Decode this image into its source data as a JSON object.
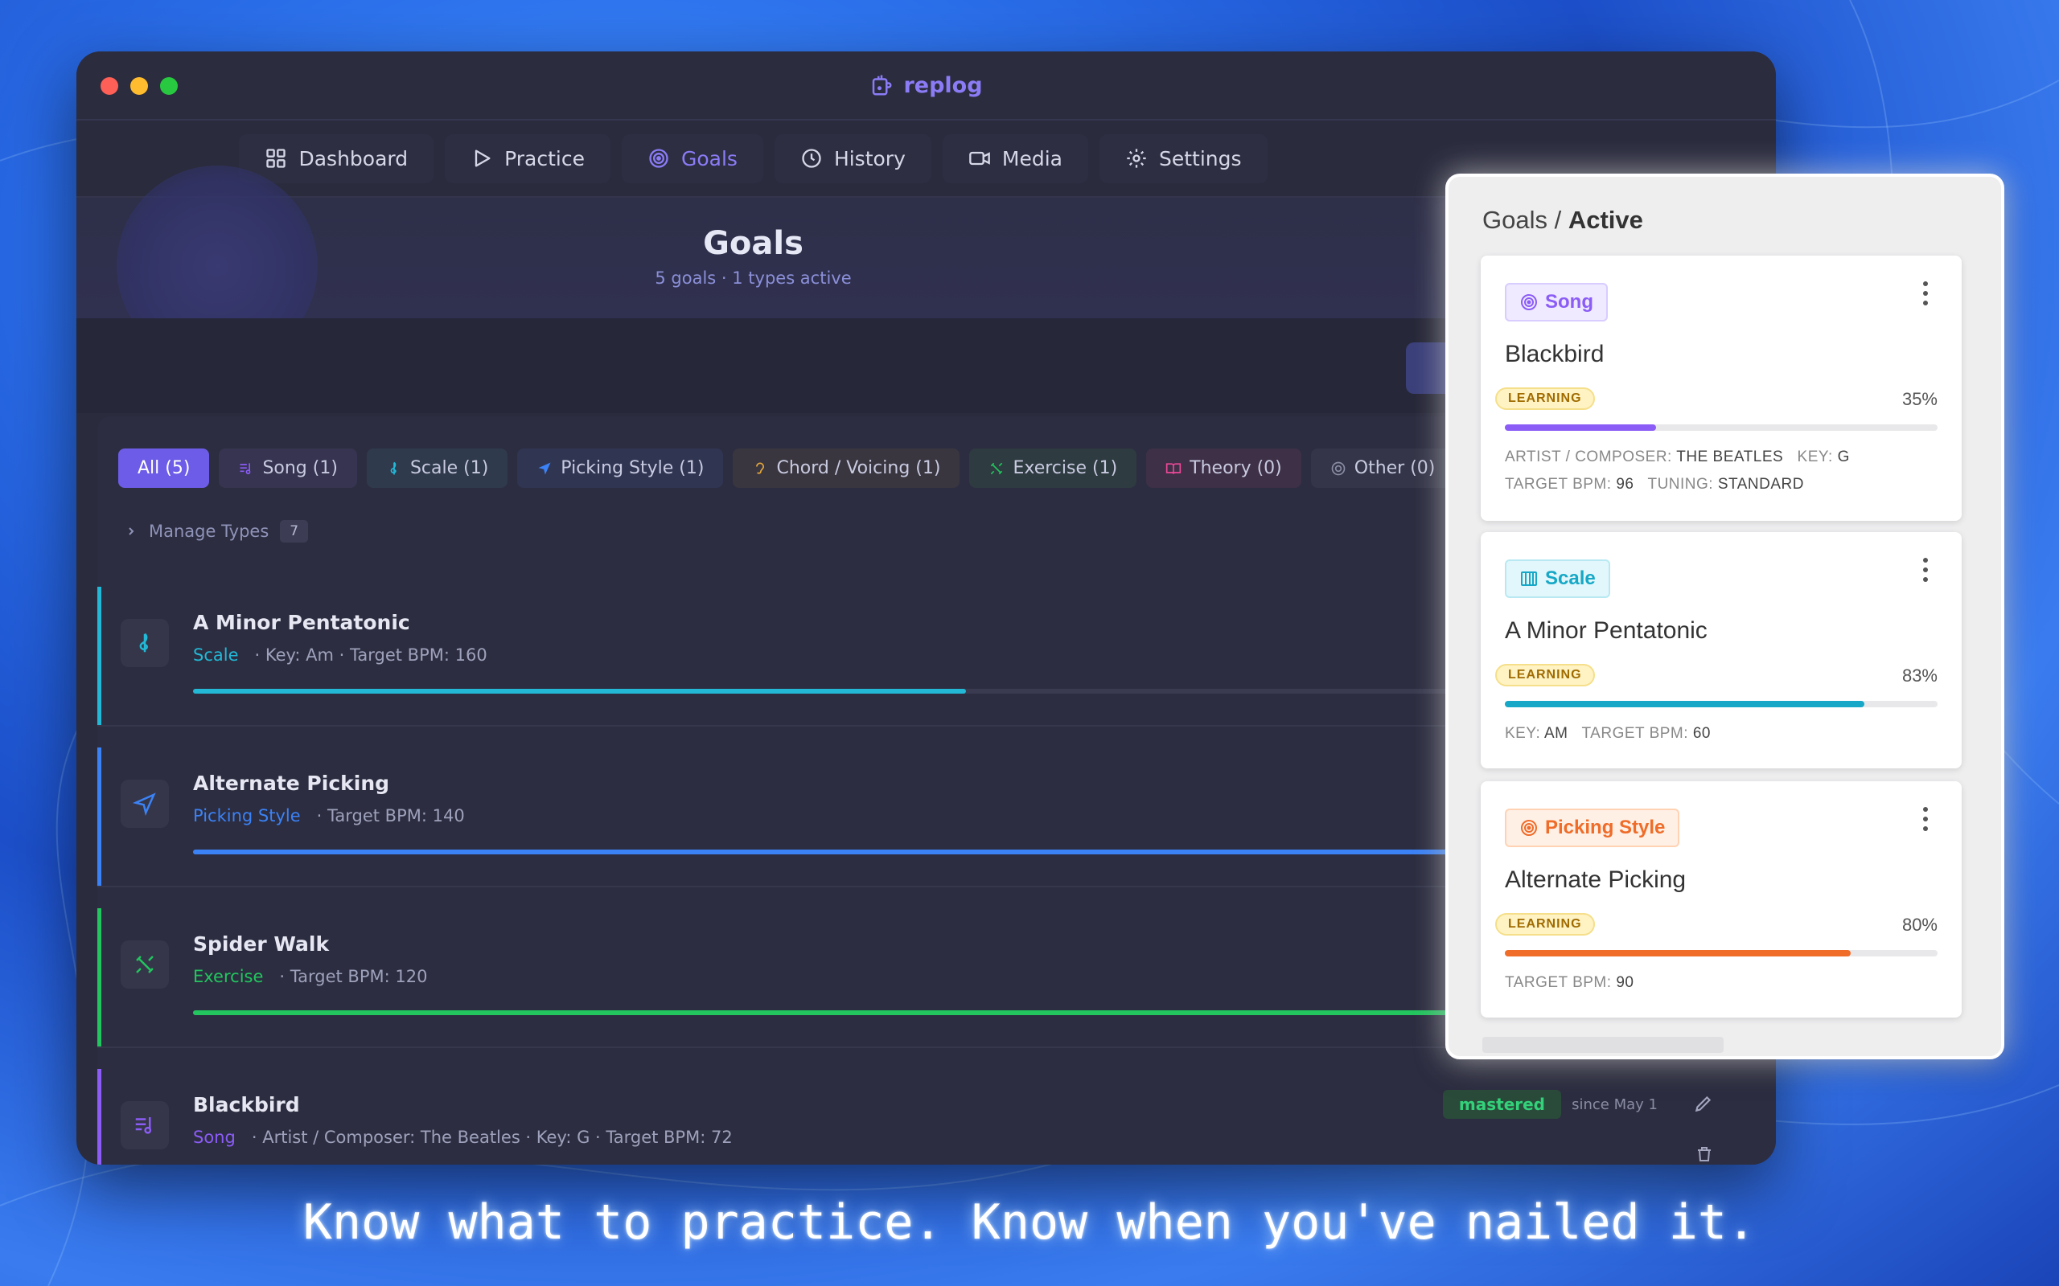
{
  "app": {
    "title": "replog"
  },
  "nav": [
    {
      "label": "Dashboard",
      "icon": "dashboard-icon"
    },
    {
      "label": "Practice",
      "icon": "play-icon"
    },
    {
      "label": "Goals",
      "icon": "target-icon",
      "active": true
    },
    {
      "label": "History",
      "icon": "clock-icon"
    },
    {
      "label": "Media",
      "icon": "video-icon"
    },
    {
      "label": "Settings",
      "icon": "gear-icon"
    }
  ],
  "hero": {
    "title": "Goals",
    "subtitle": "5 goals · 1 types active"
  },
  "filters": [
    {
      "label": "All (5)",
      "active": true
    },
    {
      "label": "Song (1)",
      "color": "#8b5cf6"
    },
    {
      "label": "Scale (1)",
      "color": "#22b8d6"
    },
    {
      "label": "Picking Style (1)",
      "color": "#3b82f6"
    },
    {
      "label": "Chord / Voicing (1)",
      "color": "#e5a93b"
    },
    {
      "label": "Exercise (1)",
      "color": "#22c55e"
    },
    {
      "label": "Theory (0)",
      "color": "#ec4899"
    },
    {
      "label": "Other (0)",
      "color": "#8a8ca4"
    }
  ],
  "manage": {
    "label": "Manage Types",
    "count": "7"
  },
  "goals": [
    {
      "name": "A Minor Pentatonic",
      "type": "Scale",
      "meta": "· Key: Am   · Target BPM: 160",
      "color": "#22b8d6",
      "progress": 0.49
    },
    {
      "name": "Alternate Picking",
      "type": "Picking Style",
      "meta": "· Target BPM: 140",
      "color": "#3b82f6",
      "progress": 0.87
    },
    {
      "name": "Spider Walk",
      "type": "Exercise",
      "meta": "· Target BPM: 120",
      "color": "#22c55e",
      "progress": 0.81
    },
    {
      "name": "Blackbird",
      "type": "Song",
      "meta": "· Artist / Composer: The Beatles   · Key: G   · Target BPM: 72",
      "color": "#8b5cf6",
      "status": "mastered",
      "since": "since May 1"
    }
  ],
  "panel": {
    "breadcrumb": "Goals /",
    "breadcrumb_active": "Active",
    "cards": [
      {
        "tag": "Song",
        "title": "Blackbird",
        "status": "LEARNING",
        "percent": "35%",
        "progress": 0.35,
        "color": "#8b5cf6",
        "details": [
          {
            "k1": "ARTIST / COMPOSER:",
            "v1": "THE BEATLES",
            "k2": "KEY:",
            "v2": "G"
          },
          {
            "k1": "TARGET BPM:",
            "v1": "96",
            "k2": "TUNING:",
            "v2": "STANDARD"
          }
        ]
      },
      {
        "tag": "Scale",
        "title": "A Minor Pentatonic",
        "status": "LEARNING",
        "percent": "83%",
        "progress": 0.83,
        "color": "#16a8c6",
        "details": [
          {
            "k1": "KEY:",
            "v1": "AM",
            "k2": "TARGET BPM:",
            "v2": "60"
          }
        ]
      },
      {
        "tag": "Picking Style",
        "title": "Alternate Picking",
        "status": "LEARNING",
        "percent": "80%",
        "progress": 0.8,
        "color": "#ef6c29",
        "details": [
          {
            "k1": "TARGET BPM:",
            "v1": "90"
          }
        ]
      }
    ]
  },
  "tagline": "Know what to practice. Know when you've nailed it."
}
